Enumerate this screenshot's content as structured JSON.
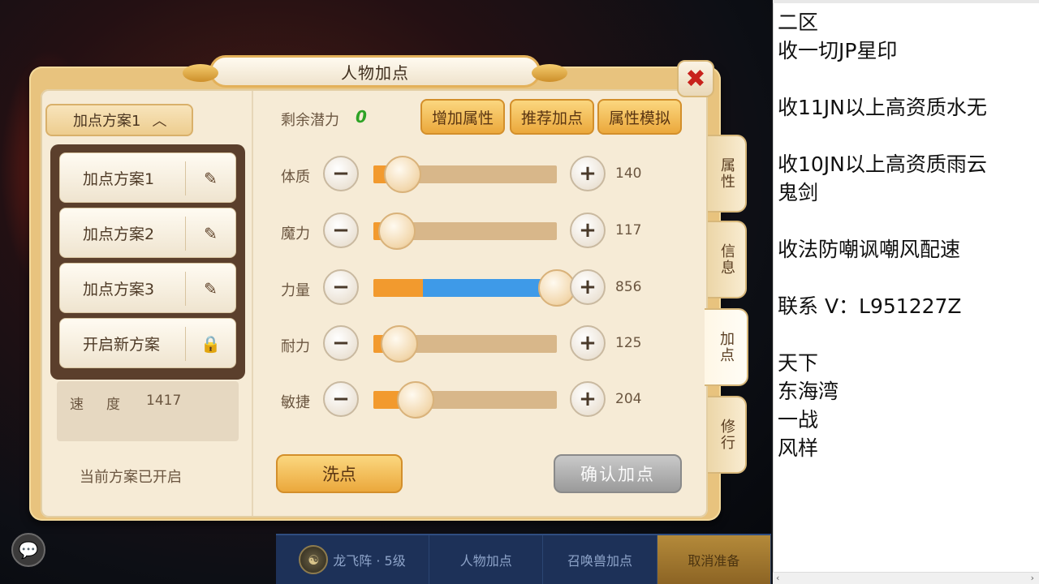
{
  "window": {
    "title": "人物加点",
    "close_icon": "close-icon"
  },
  "left": {
    "dropdown_label": "加点方案1",
    "schemes": [
      {
        "label": "加点方案1",
        "icon": "edit-icon"
      },
      {
        "label": "加点方案2",
        "icon": "edit-icon"
      },
      {
        "label": "加点方案3",
        "icon": "edit-icon"
      },
      {
        "label": "开启新方案",
        "icon": "lock-icon"
      }
    ],
    "speed_label": "速度",
    "speed_value": "1417",
    "status": "当前方案已开启"
  },
  "points": {
    "remaining_label": "剩余潜力",
    "remaining_value": "0",
    "buttons": [
      "增加属性",
      "推荐加点",
      "属性模拟"
    ]
  },
  "attributes": [
    {
      "name": "体质",
      "value": "140",
      "level": 0.16,
      "added": 0
    },
    {
      "name": "魔力",
      "value": "117",
      "level": 0.13,
      "added": 0
    },
    {
      "name": "力量",
      "value": "856",
      "level": 0.27,
      "added": 0.73
    },
    {
      "name": "耐力",
      "value": "125",
      "level": 0.14,
      "added": 0
    },
    {
      "name": "敏捷",
      "value": "204",
      "level": 0.23,
      "added": 0
    }
  ],
  "actions": {
    "wash_label": "洗点",
    "confirm_label": "确认加点"
  },
  "side_tabs": [
    {
      "label": "属性",
      "active": false
    },
    {
      "label": "信息",
      "active": false
    },
    {
      "label": "加点",
      "active": true
    },
    {
      "label": "修行",
      "active": false
    }
  ],
  "bottom_bar": {
    "formation_label": "龙飞阵 · 5级",
    "character_points": "人物加点",
    "summon_points": "召唤兽加点",
    "cancel": "取消准备"
  },
  "notes": [
    "二区",
    "收一切JP星印",
    "",
    "收11JN以上高资质水无",
    "",
    "收10JN以上高资质雨云",
    "鬼剑",
    "",
    "收法防嘲讽嘲风配速",
    "",
    "联系 V：L951227Z",
    "",
    "天下",
    "东海湾",
    "一战",
    "风样"
  ],
  "colors": {
    "accent": "#eba83c",
    "added_bar": "#3e9ae8",
    "base_bar": "#f29a2e",
    "potential": "#2ea326"
  }
}
